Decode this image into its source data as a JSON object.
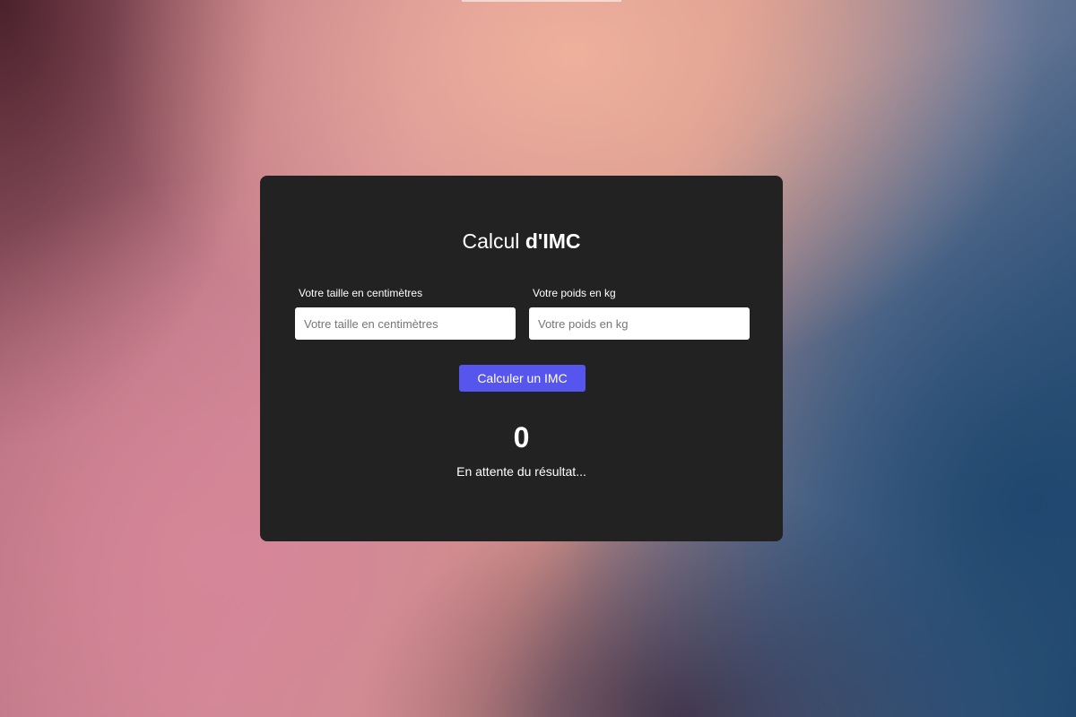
{
  "background": {
    "colors": [
      "#f0b29c",
      "#d68698",
      "#1e466e",
      "#461e28"
    ]
  },
  "card": {
    "background_color": "#222222",
    "title_prefix": "Calcul ",
    "title_bold": "d'IMC",
    "height_field": {
      "label": "Votre taille en centimètres",
      "placeholder": "Votre taille en centimètres",
      "value": ""
    },
    "weight_field": {
      "label": "Votre poids en kg",
      "placeholder": "Votre poids en kg",
      "value": ""
    },
    "calculate_button": {
      "label": "Calculer un IMC",
      "color": "#5656ee"
    },
    "result": {
      "value": "0",
      "status": "En attente du résultat..."
    }
  }
}
